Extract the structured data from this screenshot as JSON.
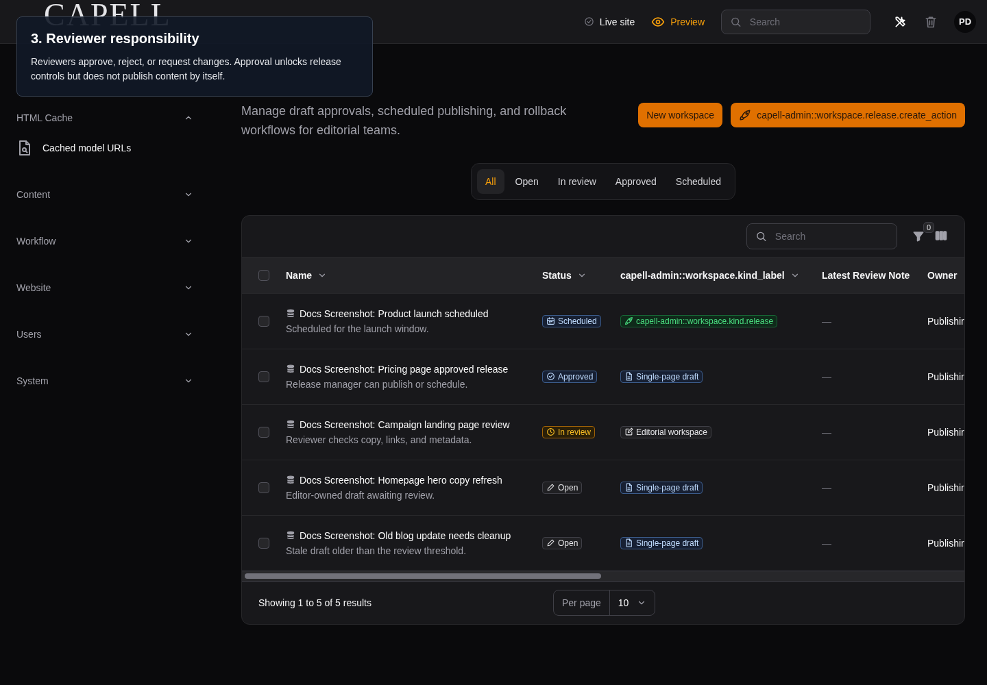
{
  "header": {
    "logo": "CAPELL",
    "live_site": "Live site",
    "preview": "Preview",
    "search": {
      "placeholder": "Search"
    },
    "avatar": "PD"
  },
  "tooltip": {
    "title": "3. Reviewer responsibility",
    "body": "Reviewers approve, reject, or request changes. Approval unlocks release controls but does not publish content by itself."
  },
  "sidebar": {
    "groups": [
      {
        "label": "HTML Cache",
        "expanded": true,
        "children": [
          {
            "label": "Cached model URLs"
          }
        ]
      },
      {
        "label": "Content",
        "expanded": false
      },
      {
        "label": "Workflow",
        "expanded": false
      },
      {
        "label": "Website",
        "expanded": false
      },
      {
        "label": "Users",
        "expanded": false
      },
      {
        "label": "System",
        "expanded": false
      }
    ]
  },
  "page": {
    "description": "Manage draft approvals, scheduled publishing, and rollback workflows for editorial teams.",
    "actions": [
      {
        "label": "New workspace",
        "kind": "plain"
      },
      {
        "label": "capell-admin::workspace.release.create_action",
        "kind": "rocket"
      }
    ]
  },
  "tabs": [
    {
      "label": "All",
      "selected": true
    },
    {
      "label": "Open",
      "selected": false
    },
    {
      "label": "In review",
      "selected": false
    },
    {
      "label": "Approved",
      "selected": false
    },
    {
      "label": "Scheduled",
      "selected": false
    }
  ],
  "table": {
    "search": {
      "placeholder": "Search"
    },
    "filter_count": "0",
    "select_all_checked": false,
    "columns": [
      {
        "label": "Name",
        "sortable": true
      },
      {
        "label": "Status",
        "sortable": true
      },
      {
        "label": "capell-admin::workspace.kind_label",
        "sortable": true
      },
      {
        "label": "Latest Review Note",
        "sortable": false
      },
      {
        "label": "Owner",
        "sortable": false
      }
    ],
    "rows": [
      {
        "name": "Docs Screenshot: Product launch scheduled",
        "description": "Scheduled for the launch window.",
        "status": {
          "label": "Scheduled",
          "kind": "scheduled"
        },
        "type": {
          "label": "capell-admin::workspace.kind.release",
          "kind": "release"
        },
        "note": "—",
        "owner": "Publishir",
        "checked": false
      },
      {
        "name": "Docs Screenshot: Pricing page approved release",
        "description": "Release manager can publish or schedule.",
        "status": {
          "label": "Approved",
          "kind": "approved"
        },
        "type": {
          "label": "Single-page draft",
          "kind": "single"
        },
        "note": "—",
        "owner": "Publishir",
        "checked": false
      },
      {
        "name": "Docs Screenshot: Campaign landing page review",
        "description": "Reviewer checks copy, links, and metadata.",
        "status": {
          "label": "In review",
          "kind": "review"
        },
        "type": {
          "label": "Editorial workspace",
          "kind": "editorial"
        },
        "note": "—",
        "owner": "Publishir",
        "checked": false
      },
      {
        "name": "Docs Screenshot: Homepage hero copy refresh",
        "description": "Editor-owned draft awaiting review.",
        "status": {
          "label": "Open",
          "kind": "open"
        },
        "type": {
          "label": "Single-page draft",
          "kind": "single"
        },
        "note": "—",
        "owner": "Publishir",
        "checked": false
      },
      {
        "name": "Docs Screenshot: Old blog update needs cleanup",
        "description": "Stale draft older than the review threshold.",
        "status": {
          "label": "Open",
          "kind": "open"
        },
        "type": {
          "label": "Single-page draft",
          "kind": "single"
        },
        "note": "—",
        "owner": "Publishir",
        "checked": false
      }
    ],
    "summary": "Showing 1 to 5 of 5 results",
    "per_page_label": "Per page",
    "per_page": "10"
  }
}
